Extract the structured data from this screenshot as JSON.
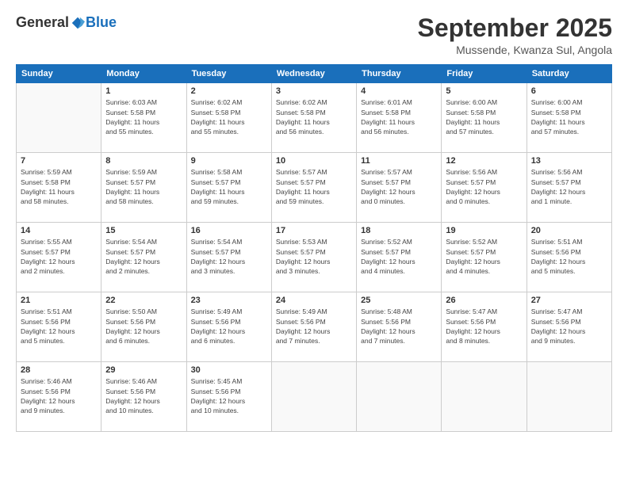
{
  "logo": {
    "general": "General",
    "blue": "Blue"
  },
  "header": {
    "month_title": "September 2025",
    "location": "Mussende, Kwanza Sul, Angola"
  },
  "days_of_week": [
    "Sunday",
    "Monday",
    "Tuesday",
    "Wednesday",
    "Thursday",
    "Friday",
    "Saturday"
  ],
  "weeks": [
    [
      {
        "day": "",
        "info": ""
      },
      {
        "day": "1",
        "info": "Sunrise: 6:03 AM\nSunset: 5:58 PM\nDaylight: 11 hours\nand 55 minutes."
      },
      {
        "day": "2",
        "info": "Sunrise: 6:02 AM\nSunset: 5:58 PM\nDaylight: 11 hours\nand 55 minutes."
      },
      {
        "day": "3",
        "info": "Sunrise: 6:02 AM\nSunset: 5:58 PM\nDaylight: 11 hours\nand 56 minutes."
      },
      {
        "day": "4",
        "info": "Sunrise: 6:01 AM\nSunset: 5:58 PM\nDaylight: 11 hours\nand 56 minutes."
      },
      {
        "day": "5",
        "info": "Sunrise: 6:00 AM\nSunset: 5:58 PM\nDaylight: 11 hours\nand 57 minutes."
      },
      {
        "day": "6",
        "info": "Sunrise: 6:00 AM\nSunset: 5:58 PM\nDaylight: 11 hours\nand 57 minutes."
      }
    ],
    [
      {
        "day": "7",
        "info": "Sunrise: 5:59 AM\nSunset: 5:58 PM\nDaylight: 11 hours\nand 58 minutes."
      },
      {
        "day": "8",
        "info": "Sunrise: 5:59 AM\nSunset: 5:57 PM\nDaylight: 11 hours\nand 58 minutes."
      },
      {
        "day": "9",
        "info": "Sunrise: 5:58 AM\nSunset: 5:57 PM\nDaylight: 11 hours\nand 59 minutes."
      },
      {
        "day": "10",
        "info": "Sunrise: 5:57 AM\nSunset: 5:57 PM\nDaylight: 11 hours\nand 59 minutes."
      },
      {
        "day": "11",
        "info": "Sunrise: 5:57 AM\nSunset: 5:57 PM\nDaylight: 12 hours\nand 0 minutes."
      },
      {
        "day": "12",
        "info": "Sunrise: 5:56 AM\nSunset: 5:57 PM\nDaylight: 12 hours\nand 0 minutes."
      },
      {
        "day": "13",
        "info": "Sunrise: 5:56 AM\nSunset: 5:57 PM\nDaylight: 12 hours\nand 1 minute."
      }
    ],
    [
      {
        "day": "14",
        "info": "Sunrise: 5:55 AM\nSunset: 5:57 PM\nDaylight: 12 hours\nand 2 minutes."
      },
      {
        "day": "15",
        "info": "Sunrise: 5:54 AM\nSunset: 5:57 PM\nDaylight: 12 hours\nand 2 minutes."
      },
      {
        "day": "16",
        "info": "Sunrise: 5:54 AM\nSunset: 5:57 PM\nDaylight: 12 hours\nand 3 minutes."
      },
      {
        "day": "17",
        "info": "Sunrise: 5:53 AM\nSunset: 5:57 PM\nDaylight: 12 hours\nand 3 minutes."
      },
      {
        "day": "18",
        "info": "Sunrise: 5:52 AM\nSunset: 5:57 PM\nDaylight: 12 hours\nand 4 minutes."
      },
      {
        "day": "19",
        "info": "Sunrise: 5:52 AM\nSunset: 5:57 PM\nDaylight: 12 hours\nand 4 minutes."
      },
      {
        "day": "20",
        "info": "Sunrise: 5:51 AM\nSunset: 5:56 PM\nDaylight: 12 hours\nand 5 minutes."
      }
    ],
    [
      {
        "day": "21",
        "info": "Sunrise: 5:51 AM\nSunset: 5:56 PM\nDaylight: 12 hours\nand 5 minutes."
      },
      {
        "day": "22",
        "info": "Sunrise: 5:50 AM\nSunset: 5:56 PM\nDaylight: 12 hours\nand 6 minutes."
      },
      {
        "day": "23",
        "info": "Sunrise: 5:49 AM\nSunset: 5:56 PM\nDaylight: 12 hours\nand 6 minutes."
      },
      {
        "day": "24",
        "info": "Sunrise: 5:49 AM\nSunset: 5:56 PM\nDaylight: 12 hours\nand 7 minutes."
      },
      {
        "day": "25",
        "info": "Sunrise: 5:48 AM\nSunset: 5:56 PM\nDaylight: 12 hours\nand 7 minutes."
      },
      {
        "day": "26",
        "info": "Sunrise: 5:47 AM\nSunset: 5:56 PM\nDaylight: 12 hours\nand 8 minutes."
      },
      {
        "day": "27",
        "info": "Sunrise: 5:47 AM\nSunset: 5:56 PM\nDaylight: 12 hours\nand 9 minutes."
      }
    ],
    [
      {
        "day": "28",
        "info": "Sunrise: 5:46 AM\nSunset: 5:56 PM\nDaylight: 12 hours\nand 9 minutes."
      },
      {
        "day": "29",
        "info": "Sunrise: 5:46 AM\nSunset: 5:56 PM\nDaylight: 12 hours\nand 10 minutes."
      },
      {
        "day": "30",
        "info": "Sunrise: 5:45 AM\nSunset: 5:56 PM\nDaylight: 12 hours\nand 10 minutes."
      },
      {
        "day": "",
        "info": ""
      },
      {
        "day": "",
        "info": ""
      },
      {
        "day": "",
        "info": ""
      },
      {
        "day": "",
        "info": ""
      }
    ]
  ]
}
